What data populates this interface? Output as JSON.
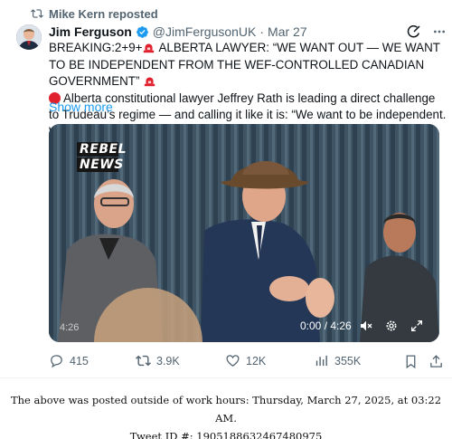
{
  "repost": {
    "icon": "repost-icon",
    "label": "Mike Kern reposted"
  },
  "author": {
    "avatar": "avatar",
    "name": "Jim Ferguson",
    "verified_icon": "verified-badge-icon",
    "handle": "@JimFergusonUK",
    "separator": "·",
    "date": "Mar 27"
  },
  "tweet": {
    "line1_a": "BREAKING:2+9+",
    "line1_b": " ALBERTA LAWYER: “WE WANT OUT — WE WANT TO BE INDEPENDENT FROM THE WEF-CONTROLLED CANADIAN GOVERNMENT” ",
    "line2": "Alberta constitutional lawyer Jeffrey Rath is leading a direct challenge to Trudeau’s regime — and calling it like it is: “We want to be independent. We",
    "show_more": "Show more"
  },
  "media": {
    "logo_line1": "REBEL",
    "logo_line2": "NEWS",
    "elapsed_overlay": "4:26",
    "time": "0:00 / 4:26"
  },
  "actions": {
    "replies": "415",
    "reposts": "3.9K",
    "likes": "12K",
    "views": "355K"
  },
  "footer": {
    "line1": "The above was posted outside of work hours: Thursday, March 27, 2025, at 03:22 AM.",
    "line2": "Tweet ID #: 1905188632467480975"
  },
  "colors": {
    "link": "#1d9bf0",
    "muted": "#536471",
    "verified": "#1d9bf0",
    "siren": "#e0212d"
  }
}
